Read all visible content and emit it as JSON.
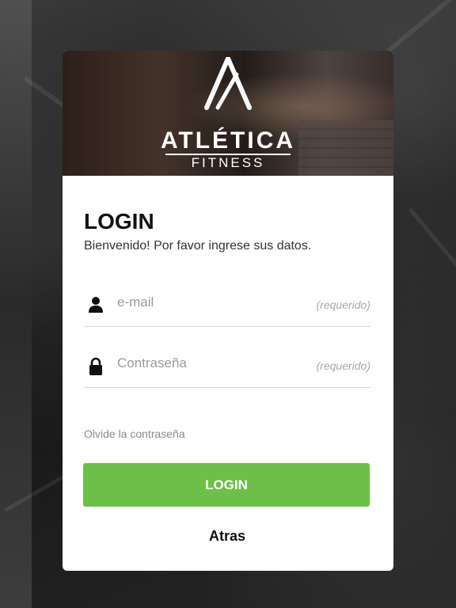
{
  "brand": {
    "name": "ATLÉTICA",
    "subtitle": "FITNESS"
  },
  "login": {
    "title": "LOGIN",
    "subtitle": "Bienvenido! Por favor ingrese sus datos.",
    "email": {
      "placeholder": "e-mail",
      "hint": "(requerido)",
      "icon": "user-icon"
    },
    "password": {
      "placeholder": "Contraseña",
      "hint": "(requerido)",
      "icon": "lock-icon"
    },
    "forgot_label": "Olvide la contraseña",
    "submit_label": "LOGIN",
    "back_label": "Atras"
  },
  "colors": {
    "accent": "#6cc04a",
    "card": "#ffffff",
    "background": "#1a1a1a"
  }
}
